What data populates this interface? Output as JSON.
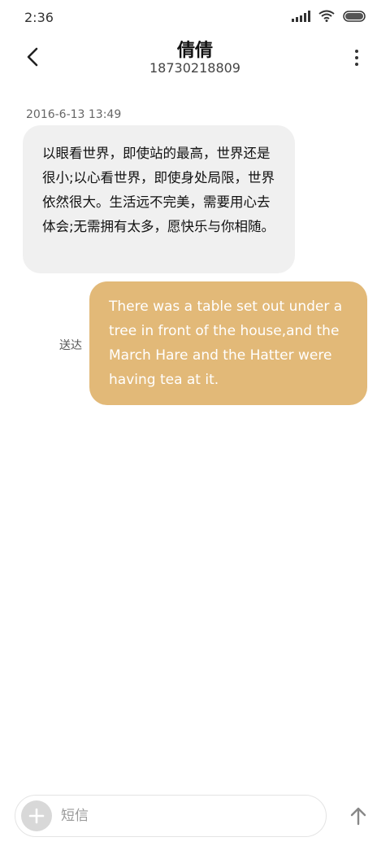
{
  "status_bar": {
    "time": "2:36"
  },
  "header": {
    "contact_name": "倩倩",
    "contact_number": "18730218809"
  },
  "conversation": {
    "timestamp": "2016-6-13 13:49",
    "incoming": {
      "text": "以眼看世界，即使站的最高，世界还是很小;以心看世界，即使身处局限，世界依然很大。生活远不完美，需要用心去体会;无需拥有太多，愿快乐与你相随。"
    },
    "outgoing": {
      "text": "There was a table set out under a tree in front of the house,and the March Hare and the Hatter were having tea at it.",
      "status": "送达"
    }
  },
  "composer": {
    "placeholder": "短信"
  },
  "colors": {
    "outgoing_bubble": "#e2b978",
    "incoming_bubble": "#f0f0f0"
  }
}
